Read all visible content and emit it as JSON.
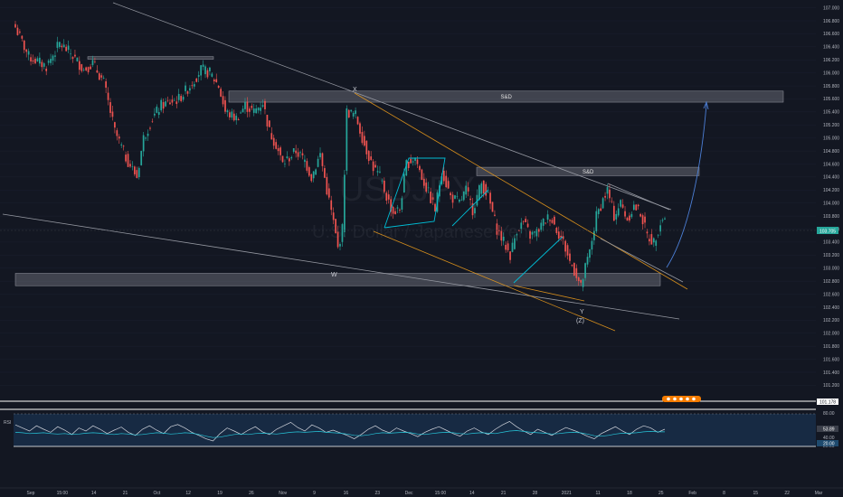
{
  "watermark": {
    "symbol": "USDJPY",
    "description": "U.S. Dollar / Japanese Yen"
  },
  "colors": {
    "background": "#131722",
    "up": "#26a69a",
    "down": "#ef5350",
    "channel": "#f7a21b",
    "trendline": "#9598a1",
    "pattern": "#00bcd4",
    "projection": "#4c7fd6",
    "zone": "#787b86",
    "rsi": "#d1d4dc",
    "rsi_ma": "#26c6da",
    "price_tag": "#26a69a"
  },
  "chart_data": [
    {
      "type": "candlestick",
      "title": "",
      "price_axis_ticks": [
        "107.000",
        "106.800",
        "106.600",
        "106.400",
        "106.200",
        "106.000",
        "105.800",
        "105.600",
        "105.400",
        "105.200",
        "105.000",
        "104.800",
        "104.600",
        "104.400",
        "104.200",
        "104.000",
        "103.800",
        "103.600",
        "103.400",
        "103.200",
        "103.000",
        "102.800",
        "102.600",
        "102.400",
        "102.200",
        "102.000",
        "101.800",
        "101.600",
        "101.400",
        "101.200"
      ],
      "ylim": [
        101.15,
        107.05
      ],
      "time_axis_labels": [
        "Sep",
        "15:00",
        "14",
        "21",
        "Oct",
        "12",
        "19",
        "26",
        "Nov",
        "9",
        "16",
        "23",
        "Dec",
        "15:00",
        "14",
        "21",
        "28",
        "2021",
        "11",
        "18",
        "25",
        "Feb",
        "8",
        "15",
        "22",
        "Mar"
      ],
      "current_price": "103.705",
      "lower_price_tag": "101.178",
      "anchors": [
        {
          "i": 0,
          "p": 106.7
        },
        {
          "i": 6,
          "p": 106.25
        },
        {
          "i": 14,
          "p": 106.1
        },
        {
          "i": 20,
          "p": 106.45
        },
        {
          "i": 25,
          "p": 106.3
        },
        {
          "i": 31,
          "p": 106.05
        },
        {
          "i": 35,
          "p": 106.15
        },
        {
          "i": 40,
          "p": 105.85
        },
        {
          "i": 45,
          "p": 105.1
        },
        {
          "i": 50,
          "p": 104.7
        },
        {
          "i": 55,
          "p": 104.4
        },
        {
          "i": 58,
          "p": 105.0
        },
        {
          "i": 62,
          "p": 105.3
        },
        {
          "i": 66,
          "p": 105.5
        },
        {
          "i": 70,
          "p": 105.55
        },
        {
          "i": 74,
          "p": 105.6
        },
        {
          "i": 79,
          "p": 105.8
        },
        {
          "i": 84,
          "p": 106.05
        },
        {
          "i": 88,
          "p": 106.0
        },
        {
          "i": 92,
          "p": 105.8
        },
        {
          "i": 95,
          "p": 105.4
        },
        {
          "i": 100,
          "p": 105.3
        },
        {
          "i": 104,
          "p": 105.5
        },
        {
          "i": 108,
          "p": 105.4
        },
        {
          "i": 112,
          "p": 105.55
        },
        {
          "i": 115,
          "p": 105.1
        },
        {
          "i": 118,
          "p": 104.9
        },
        {
          "i": 121,
          "p": 104.6
        },
        {
          "i": 124,
          "p": 104.7
        },
        {
          "i": 127,
          "p": 104.8
        },
        {
          "i": 131,
          "p": 104.65
        },
        {
          "i": 134,
          "p": 104.4
        },
        {
          "i": 138,
          "p": 104.75
        },
        {
          "i": 141,
          "p": 104.2
        },
        {
          "i": 144,
          "p": 103.7
        },
        {
          "i": 146,
          "p": 103.3
        },
        {
          "i": 148,
          "p": 103.6
        },
        {
          "i": 150,
          "p": 105.4
        },
        {
          "i": 154,
          "p": 105.35
        },
        {
          "i": 158,
          "p": 104.9
        },
        {
          "i": 162,
          "p": 104.55
        },
        {
          "i": 165,
          "p": 104.4
        },
        {
          "i": 168,
          "p": 104.1
        },
        {
          "i": 171,
          "p": 103.85
        },
        {
          "i": 174,
          "p": 103.9
        },
        {
          "i": 177,
          "p": 104.6
        },
        {
          "i": 181,
          "p": 104.7
        },
        {
          "i": 184,
          "p": 104.4
        },
        {
          "i": 187,
          "p": 104.15
        },
        {
          "i": 190,
          "p": 103.9
        },
        {
          "i": 193,
          "p": 104.5
        },
        {
          "i": 197,
          "p": 104.1
        },
        {
          "i": 201,
          "p": 104.0
        },
        {
          "i": 204,
          "p": 104.2
        },
        {
          "i": 207,
          "p": 103.9
        },
        {
          "i": 211,
          "p": 104.3
        },
        {
          "i": 214,
          "p": 104.1
        },
        {
          "i": 218,
          "p": 103.6
        },
        {
          "i": 221,
          "p": 103.4
        },
        {
          "i": 224,
          "p": 103.2
        },
        {
          "i": 227,
          "p": 103.6
        },
        {
          "i": 230,
          "p": 103.7
        },
        {
          "i": 233,
          "p": 103.5
        },
        {
          "i": 236,
          "p": 103.55
        },
        {
          "i": 239,
          "p": 103.7
        },
        {
          "i": 242,
          "p": 103.8
        },
        {
          "i": 245,
          "p": 103.6
        },
        {
          "i": 248,
          "p": 103.4
        },
        {
          "i": 251,
          "p": 103.1
        },
        {
          "i": 254,
          "p": 102.9
        },
        {
          "i": 256,
          "p": 102.7
        },
        {
          "i": 258,
          "p": 103.0
        },
        {
          "i": 260,
          "p": 103.25
        },
        {
          "i": 263,
          "p": 103.8
        },
        {
          "i": 266,
          "p": 104.05
        },
        {
          "i": 268,
          "p": 104.2
        },
        {
          "i": 271,
          "p": 103.8
        },
        {
          "i": 274,
          "p": 104.0
        },
        {
          "i": 277,
          "p": 103.75
        },
        {
          "i": 280,
          "p": 103.95
        },
        {
          "i": 283,
          "p": 103.85
        },
        {
          "i": 286,
          "p": 103.5
        },
        {
          "i": 289,
          "p": 103.4
        },
        {
          "i": 292,
          "p": 103.7
        },
        {
          "i": 294,
          "p": 103.8
        }
      ],
      "zones": [
        {
          "label": "S&D",
          "price_top": 105.72,
          "price_bottom": 105.55
        },
        {
          "label": "S&D",
          "price_top": 104.55,
          "price_bottom": 104.42
        },
        {
          "label": "",
          "price_top": 102.92,
          "price_bottom": 102.73
        },
        {
          "label": "",
          "price_top": 106.25,
          "price_bottom": 106.21
        }
      ],
      "wave_labels": [
        "X",
        "W",
        "Y",
        "(Z)"
      ]
    },
    {
      "type": "line",
      "title": "RSI",
      "ylim": [
        0,
        100
      ],
      "levels": [
        70,
        30
      ],
      "axis_ticks": [
        "80.00",
        "40.00",
        "20.00"
      ],
      "value_labels": [
        "53.89",
        "20.00"
      ],
      "series": [
        {
          "values": [
            62,
            55,
            48,
            60,
            52,
            45,
            58,
            50,
            40,
            55,
            48,
            60,
            52,
            42,
            50,
            57,
            45,
            38,
            52,
            60,
            50,
            42,
            58,
            63,
            55,
            45,
            38,
            30,
            25,
            42,
            55,
            48,
            40,
            50,
            58,
            46,
            40,
            52,
            60,
            68,
            56,
            48,
            62,
            55,
            45,
            50,
            44,
            38,
            30,
            40,
            52,
            60,
            50,
            44,
            55,
            48,
            42,
            35,
            45,
            52,
            58,
            50,
            42,
            36,
            48,
            55,
            46,
            40,
            52,
            62,
            70,
            58,
            48,
            40,
            52,
            45,
            38,
            48,
            56,
            50,
            44,
            36,
            30,
            42,
            50,
            58,
            48,
            40,
            52,
            60,
            55,
            45,
            52
          ]
        },
        {
          "values": [
            45,
            44,
            42,
            43,
            44,
            42,
            41,
            42,
            40,
            41,
            43,
            44,
            43,
            41,
            40,
            42,
            41,
            39,
            40,
            42,
            44,
            43,
            41,
            42,
            44,
            43,
            40,
            36,
            33,
            34,
            37,
            40,
            41,
            40,
            42,
            43,
            42,
            41,
            43,
            45,
            46,
            45,
            46,
            47,
            45,
            44,
            43,
            41,
            38,
            37,
            39,
            42,
            44,
            43,
            44,
            45,
            44,
            41,
            40,
            42,
            44,
            45,
            44,
            42,
            41,
            43,
            44,
            43,
            42,
            45,
            48,
            49,
            47,
            45,
            44,
            43,
            41,
            42,
            44,
            45,
            44,
            41,
            37,
            36,
            38,
            41,
            43,
            43,
            44,
            46,
            47,
            46,
            46
          ]
        }
      ]
    }
  ]
}
